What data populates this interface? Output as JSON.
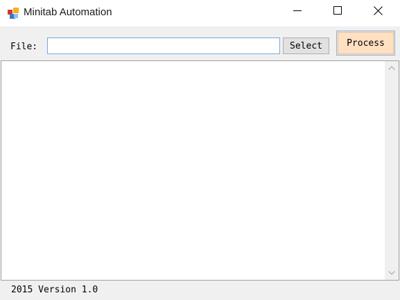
{
  "window": {
    "title": "Minitab Automation",
    "icon": "minitab-app-icon",
    "controls": {
      "minimize_icon": "minimize-icon",
      "maximize_icon": "maximize-icon",
      "close_icon": "close-icon"
    }
  },
  "form": {
    "file_label": "File:",
    "file_value": "",
    "file_placeholder": "",
    "select_label": "Select",
    "process_label": "Process"
  },
  "output": {
    "text": "",
    "scroll_up_icon": "chevron-up-icon",
    "scroll_down_icon": "chevron-down-icon"
  },
  "status": {
    "text": "2015 Version 1.0"
  },
  "colors": {
    "process_button_bg": "#ffe0c2",
    "input_border": "#7aa7d9",
    "window_bg": "#f0f0f0"
  }
}
